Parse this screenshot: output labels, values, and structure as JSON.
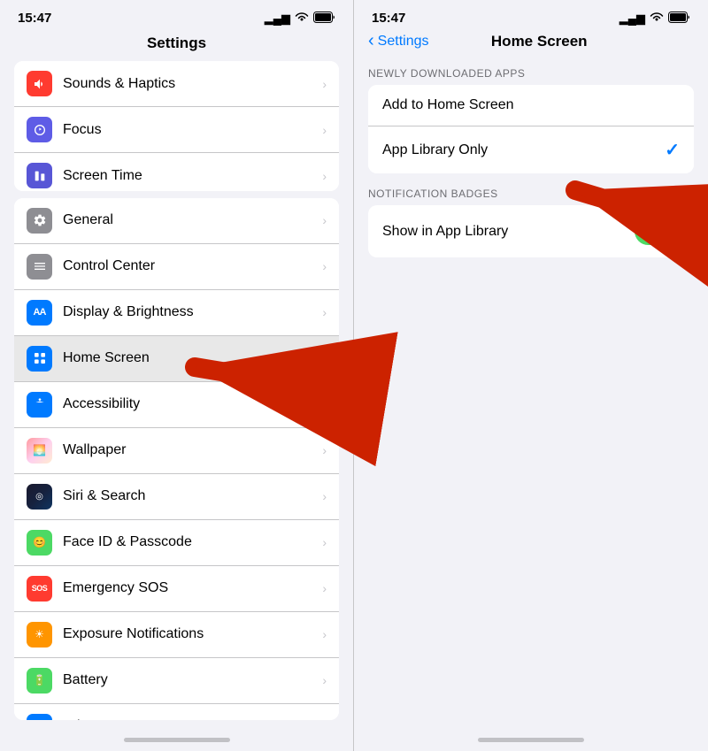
{
  "left": {
    "statusBar": {
      "time": "15:47",
      "signal": "▂▄▆",
      "wifi": "WiFi",
      "battery": "🔋"
    },
    "title": "Settings",
    "groups": [
      {
        "items": [
          {
            "id": "sounds",
            "label": "Sounds & Haptics",
            "iconClass": "icon-sounds",
            "iconText": "🔔"
          },
          {
            "id": "focus",
            "label": "Focus",
            "iconClass": "icon-focus",
            "iconText": "🌙"
          },
          {
            "id": "screentime",
            "label": "Screen Time",
            "iconClass": "icon-screentime",
            "iconText": "⏱"
          }
        ]
      },
      {
        "items": [
          {
            "id": "general",
            "label": "General",
            "iconClass": "icon-general",
            "iconText": "⚙️"
          },
          {
            "id": "control",
            "label": "Control Center",
            "iconClass": "icon-control",
            "iconText": "☰"
          },
          {
            "id": "display",
            "label": "Display & Brightness",
            "iconClass": "icon-display",
            "iconText": "AA"
          },
          {
            "id": "homescreen",
            "label": "Home Screen",
            "iconClass": "icon-homescreen",
            "iconText": "⋮⋮"
          },
          {
            "id": "accessibility",
            "label": "Accessibility",
            "iconClass": "icon-accessibility",
            "iconText": "♿"
          },
          {
            "id": "wallpaper",
            "label": "Wallpaper",
            "iconClass": "icon-wallpaper",
            "iconText": "🌅"
          },
          {
            "id": "siri",
            "label": "Siri & Search",
            "iconClass": "icon-siri",
            "iconText": "◎"
          },
          {
            "id": "faceid",
            "label": "Face ID & Passcode",
            "iconClass": "icon-faceid",
            "iconText": "😊"
          },
          {
            "id": "sos",
            "label": "Emergency SOS",
            "iconClass": "icon-sos",
            "iconText": "SOS"
          },
          {
            "id": "exposure",
            "label": "Exposure Notifications",
            "iconClass": "icon-exposure",
            "iconText": "☀"
          },
          {
            "id": "battery",
            "label": "Battery",
            "iconClass": "icon-battery",
            "iconText": "🔋"
          },
          {
            "id": "privacy",
            "label": "Privacy",
            "iconClass": "icon-privacy",
            "iconText": "✋"
          }
        ]
      }
    ]
  },
  "right": {
    "statusBar": {
      "time": "15:47"
    },
    "backLabel": "Settings",
    "title": "Home Screen",
    "sections": [
      {
        "header": "NEWLY DOWNLOADED APPS",
        "items": [
          {
            "id": "add-home",
            "label": "Add to Home Screen",
            "hasCheck": false
          },
          {
            "id": "app-library",
            "label": "App Library Only",
            "hasCheck": true
          }
        ]
      },
      {
        "header": "NOTIFICATION BADGES",
        "items": [
          {
            "id": "show-app-library",
            "label": "Show in App Library",
            "hasToggle": true,
            "toggleOn": true
          }
        ]
      }
    ]
  }
}
